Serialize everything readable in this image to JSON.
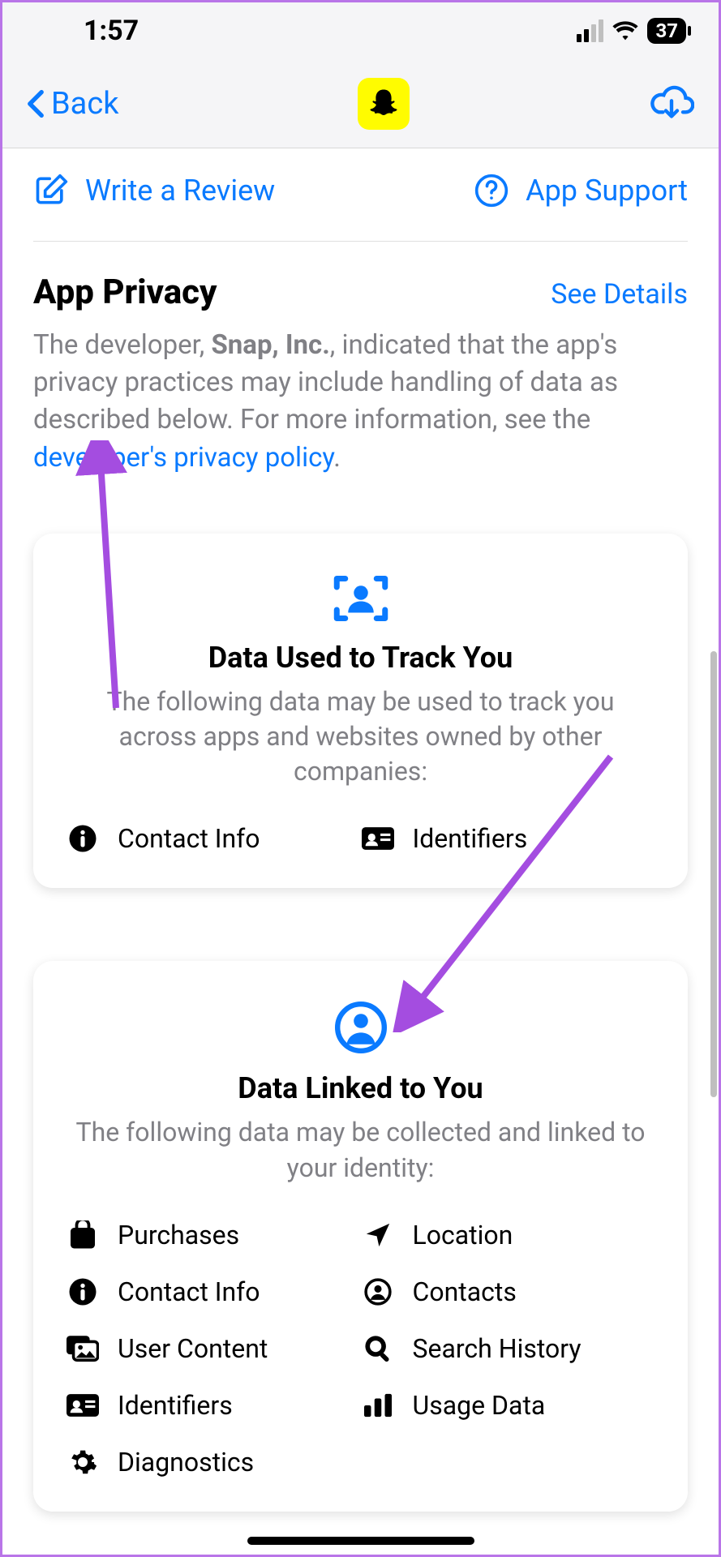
{
  "status": {
    "time": "1:57",
    "battery": "37"
  },
  "nav": {
    "back": "Back"
  },
  "actions": {
    "review": "Write a Review",
    "support": "App Support"
  },
  "privacy": {
    "title": "App Privacy",
    "see_details": "See Details",
    "desc1": "The developer, ",
    "developer": "Snap, Inc.",
    "desc2": ", indicated that the app's privacy practices may include handling of data as described below. For more information, see the ",
    "policy_link": "developer's privacy policy",
    "desc3": "."
  },
  "card1": {
    "title": "Data Used to Track You",
    "desc": "The following data may be used to track you across apps and websites owned by other companies:",
    "items": [
      "Contact Info",
      "Identifiers"
    ]
  },
  "card2": {
    "title": "Data Linked to You",
    "desc": "The following data may be collected and linked to your identity:",
    "items": [
      "Purchases",
      "Location",
      "Contact Info",
      "Contacts",
      "User Content",
      "Search History",
      "Identifiers",
      "Usage Data",
      "Diagnostics"
    ]
  }
}
